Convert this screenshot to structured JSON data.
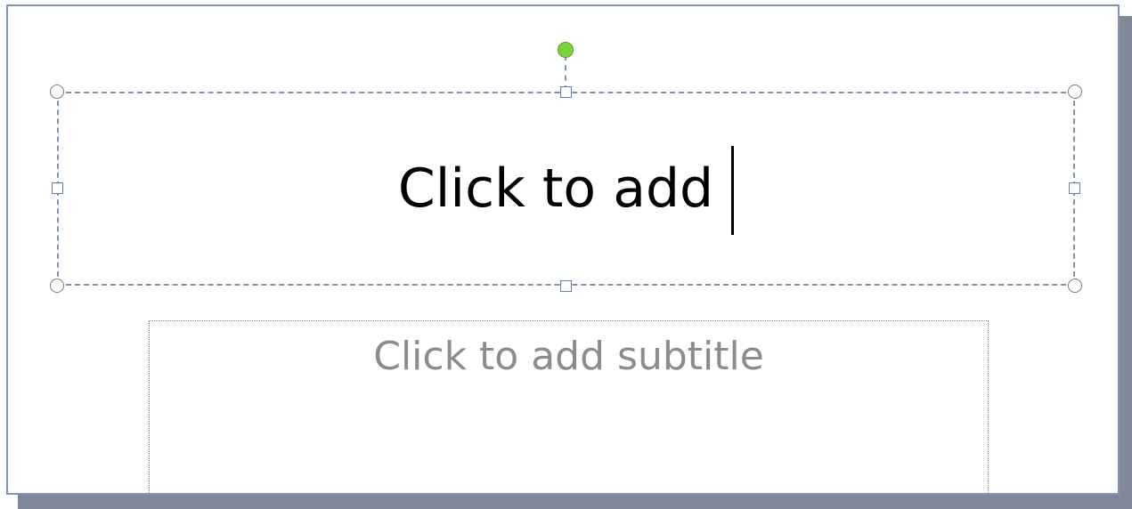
{
  "slide": {
    "title_placeholder": {
      "text": "Click to add",
      "selected": true,
      "cursor_visible": true
    },
    "subtitle_placeholder": {
      "text": "Click to add subtitle"
    },
    "colors": {
      "slide_border": "#8094b4",
      "shadow": "#7f8898",
      "selection_border": "#7f93ad",
      "rotate_handle": "#7dd23a",
      "title_text": "#000000",
      "subtitle_text": "#8c8c8c"
    }
  }
}
